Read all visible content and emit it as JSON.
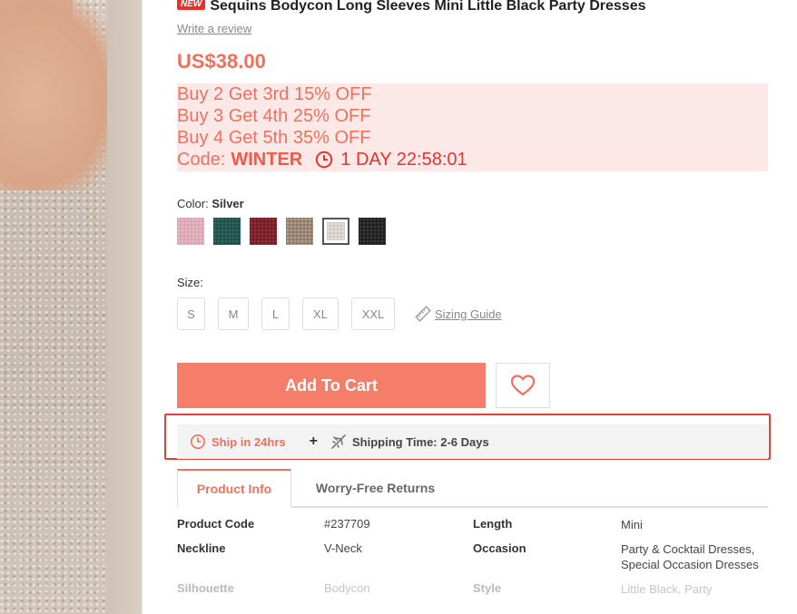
{
  "product": {
    "badge": "NEW",
    "title": "Sequins Bodycon Long Sleeves Mini Little Black Party Dresses",
    "review_link": "Write a review",
    "price": "US$38.00"
  },
  "promo": {
    "lines": [
      "Buy 2 Get 3rd 15% OFF",
      "Buy 3 Get 4th 25% OFF",
      "Buy 4 Get 5th 35% OFF"
    ],
    "code_label": "Code:",
    "code": "WINTER",
    "countdown": "1 DAY 22:58:01"
  },
  "color": {
    "label": "Color:",
    "selected": "Silver",
    "swatches": [
      {
        "name": "pink",
        "color": "#d7a2ae"
      },
      {
        "name": "green",
        "color": "#1f4a45"
      },
      {
        "name": "burgundy",
        "color": "#6e1a22"
      },
      {
        "name": "champagne",
        "color": "#8c7666"
      },
      {
        "name": "silver",
        "color": "#cbc6c1",
        "selected": true
      },
      {
        "name": "black",
        "color": "#1b1b1b"
      }
    ]
  },
  "size": {
    "label": "Size:",
    "options": [
      "S",
      "M",
      "L",
      "XL",
      "XXL"
    ],
    "guide": "Sizing Guide"
  },
  "actions": {
    "add_to_cart": "Add To Cart"
  },
  "shipping": {
    "fast": "Ship in 24hrs",
    "time": "Shipping Time: 2-6 Days"
  },
  "tabs": {
    "product_info": "Product Info",
    "returns": "Worry-Free Returns"
  },
  "specs": [
    {
      "k1": "Product Code",
      "v1": "#237709",
      "k2": "Length",
      "v2": "Mini"
    },
    {
      "k1": "Neckline",
      "v1": "V-Neck",
      "k2": "Occasion",
      "v2": "Party & Cocktail Dresses, Special Occasion Dresses"
    },
    {
      "k1": "Silhouette",
      "v1": "Bodycon",
      "k2": "Style",
      "v2": "Little Black, Party"
    }
  ],
  "colors": {
    "accent": "#f0705c",
    "button": "#f47e6a",
    "highlight_border": "#e53f37",
    "promo_bg": "#fde8e8"
  }
}
